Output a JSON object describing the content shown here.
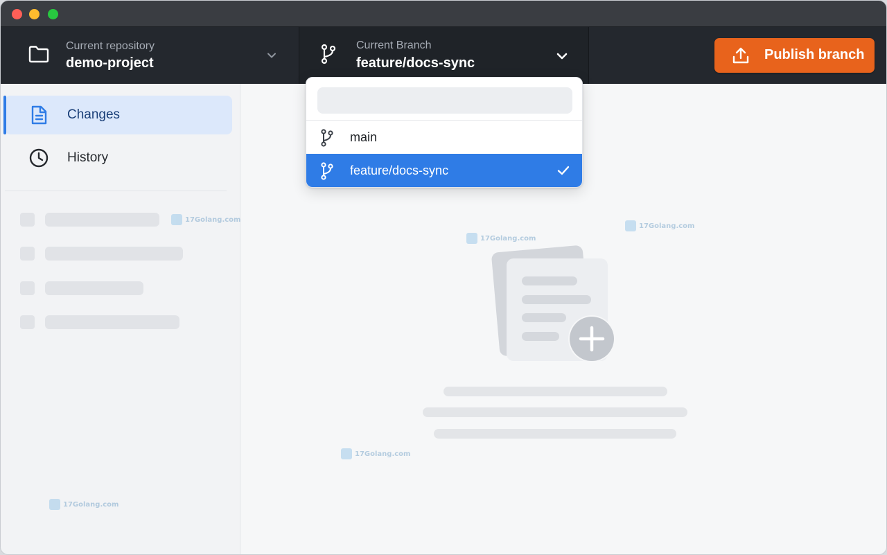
{
  "window": {
    "traffic_lights": [
      "close",
      "minimize",
      "zoom"
    ]
  },
  "toolbar": {
    "repository": {
      "caption": "Current repository",
      "value": "demo-project",
      "icon": "folder-icon"
    },
    "branch": {
      "caption": "Current Branch",
      "value": "feature/docs-sync",
      "icon": "git-branch-icon"
    },
    "publish": {
      "label": "Publish branch",
      "icon": "upload-icon"
    }
  },
  "sidebar": {
    "items": [
      {
        "label": "Changes",
        "icon": "document-icon",
        "selected": true
      },
      {
        "label": "History",
        "icon": "clock-icon",
        "selected": false
      }
    ]
  },
  "branch_dropdown": {
    "filter_value": "",
    "items": [
      {
        "label": "main",
        "icon": "git-branch-icon",
        "selected": false
      },
      {
        "label": "feature/docs-sync",
        "icon": "git-branch-icon",
        "selected": true
      }
    ]
  },
  "watermarks": [
    {
      "text": "17Golang.com"
    },
    {
      "text": "17Golang.com"
    },
    {
      "text": "17Golang.com"
    },
    {
      "text": "17Golang.com"
    },
    {
      "text": "17Golang.com"
    }
  ],
  "colors": {
    "accent_blue": "#2f7ce6",
    "publish_orange": "#e8631c",
    "toolbar_bg": "#24282e",
    "sidebar_selected_bg": "#dce8fb"
  }
}
